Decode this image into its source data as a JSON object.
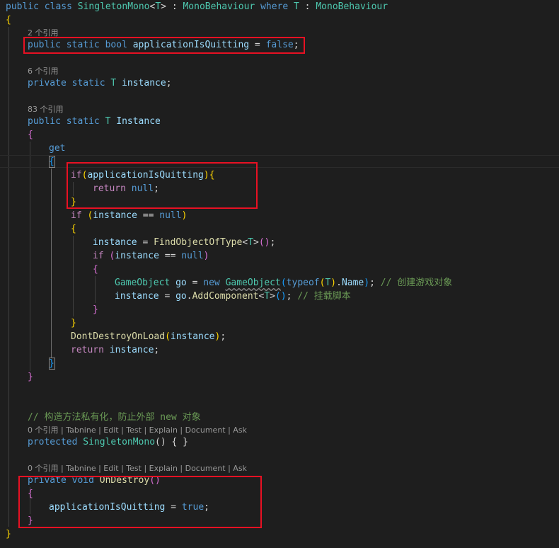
{
  "lenses": {
    "refs2": "2 个引用",
    "refs6": "6 个引用",
    "refs83": "83 个引用",
    "ctor": "0 个引用 | Tabnine | Edit | Test | Explain | Document | Ask",
    "destroy": "0 个引用 | Tabnine | Edit | Test | Explain | Document | Ask"
  },
  "code": {
    "l1": [
      "public",
      " ",
      "class",
      " ",
      "SingletonMono",
      "<",
      "T",
      "> : ",
      "MonoBehaviour",
      " ",
      "where",
      " ",
      "T",
      " : ",
      "MonoBehaviour"
    ],
    "l2": [
      "{"
    ],
    "l3": [
      "public",
      " ",
      "static",
      " ",
      "bool",
      " ",
      "applicationIsQuitting",
      " = ",
      "false",
      ";"
    ],
    "l4": [
      "private",
      " ",
      "static",
      " ",
      "T",
      " ",
      "instance",
      ";"
    ],
    "l5": [
      "public",
      " ",
      "static",
      " ",
      "T",
      " ",
      "Instance"
    ],
    "l6": [
      "{"
    ],
    "l7": [
      "get"
    ],
    "l8": [
      "{"
    ],
    "l9": [
      "if",
      "(",
      "applicationIsQuitting",
      ")",
      "{"
    ],
    "l10": [
      "return",
      " ",
      "null",
      ";"
    ],
    "l11": [
      "}"
    ],
    "l12": [
      "if",
      " ",
      "(",
      "instance",
      " == ",
      "null",
      ")"
    ],
    "l13": [
      "{"
    ],
    "l14": [
      "instance",
      " = ",
      "FindObjectOfType",
      "<",
      "T",
      ">",
      "()",
      ";"
    ],
    "l15": [
      "if",
      " ",
      "(",
      "instance",
      " == ",
      "null",
      ")"
    ],
    "l16": [
      "{"
    ],
    "l17": [
      "GameObject",
      " ",
      "go",
      " = ",
      "new",
      " ",
      "GameObject",
      "(",
      "typeof",
      "(",
      "T",
      ")",
      ".",
      "Name",
      ")",
      "; ",
      "// 创建游戏对象"
    ],
    "l18": [
      "instance",
      " = ",
      "go",
      ".",
      "AddComponent",
      "<",
      "T",
      ">",
      "()",
      "; ",
      "// 挂载脚本"
    ],
    "l19": [
      "}"
    ],
    "l20": [
      "}"
    ],
    "l21": [
      "DontDestroyOnLoad",
      "(",
      "instance",
      ")",
      ";"
    ],
    "l22": [
      "return",
      " ",
      "instance",
      ";"
    ],
    "l23": [
      "}"
    ],
    "l24": [
      "}"
    ],
    "l25": [
      "// 构造方法私有化，防止外部 new 对象"
    ],
    "l26": [
      "protected",
      " ",
      "SingletonMono",
      "() { }"
    ],
    "l27": [
      "private",
      " ",
      "void",
      " ",
      "OnDestroy",
      "()"
    ],
    "l28": [
      "{"
    ],
    "l29": [
      "applicationIsQuitting",
      " = ",
      "true",
      ";"
    ],
    "l30": [
      "}"
    ],
    "l31": [
      "}"
    ]
  },
  "colors": {
    "background": "#1e1e1e",
    "keyword": "#569cd6",
    "control": "#c586c0",
    "type": "#4ec9b0",
    "variable": "#9cdcfe",
    "function": "#dcdcaa",
    "comment": "#6a9955",
    "highlight_box": "#e81123"
  }
}
